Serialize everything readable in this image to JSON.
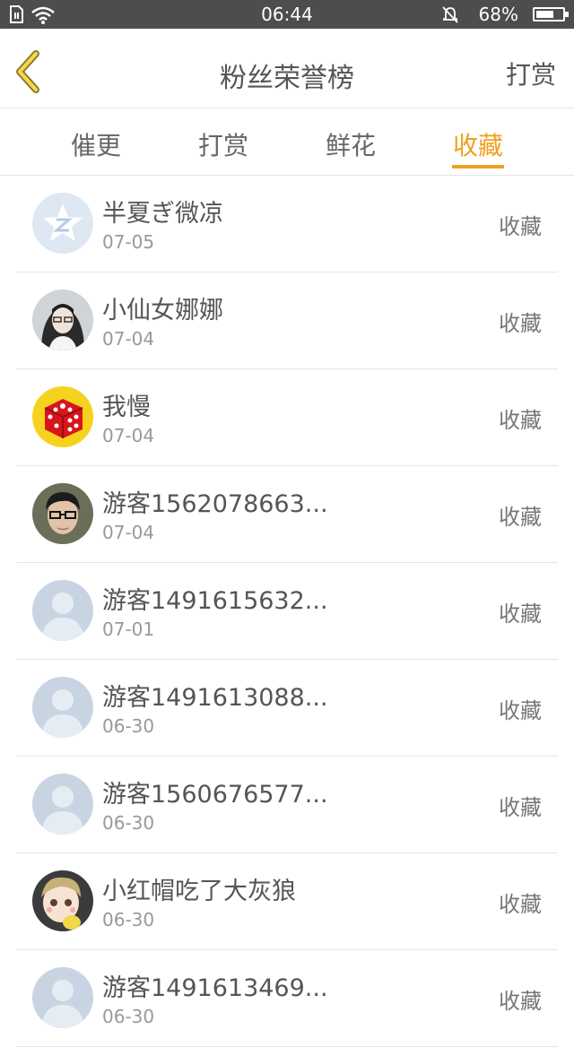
{
  "status_bar": {
    "time": "06:44",
    "battery_percent": "68%",
    "battery_level": 0.68,
    "icons": [
      "sim-icon",
      "wifi-icon",
      "bell-off-icon",
      "battery-icon"
    ]
  },
  "header": {
    "title": "粉丝荣誉榜",
    "action_label": "打赏",
    "back_icon": "chevron-left-icon"
  },
  "tabs": [
    {
      "label": "催更",
      "active": false
    },
    {
      "label": "打赏",
      "active": false
    },
    {
      "label": "鲜花",
      "active": false
    },
    {
      "label": "收藏",
      "active": true
    }
  ],
  "colors": {
    "accent": "#f0a020",
    "status_bar": "#4d4d4d",
    "text": "#555555",
    "secondary_text": "#999999"
  },
  "list": [
    {
      "name": "半夏ぎ微凉",
      "date": "07-05",
      "action": "收藏",
      "avatar": "qq-star-avatar"
    },
    {
      "name": "小仙女娜娜",
      "date": "07-04",
      "action": "收藏",
      "avatar": "photo-girl-avatar"
    },
    {
      "name": "我慢",
      "date": "07-04",
      "action": "收藏",
      "avatar": "red-dice-avatar"
    },
    {
      "name": "游客1562078663...",
      "date": "07-04",
      "action": "收藏",
      "avatar": "photo-boy-glasses-avatar"
    },
    {
      "name": "游客1491615632...",
      "date": "07-01",
      "action": "收藏",
      "avatar": "default-user-avatar"
    },
    {
      "name": "游客1491613088...",
      "date": "06-30",
      "action": "收藏",
      "avatar": "default-user-avatar"
    },
    {
      "name": "游客1560676577...",
      "date": "06-30",
      "action": "收藏",
      "avatar": "default-user-avatar"
    },
    {
      "name": "小红帽吃了大灰狼",
      "date": "06-30",
      "action": "收藏",
      "avatar": "anime-kid-avatar"
    },
    {
      "name": "游客1491613469...",
      "date": "06-30",
      "action": "收藏",
      "avatar": "default-user-avatar"
    }
  ]
}
